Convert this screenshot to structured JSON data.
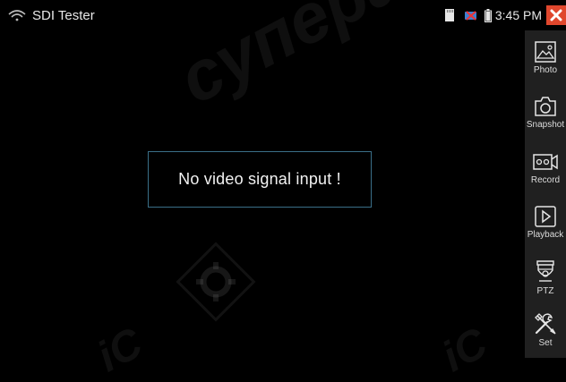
{
  "status_bar": {
    "app_title": "SDI Tester",
    "clock": "3:45 PM"
  },
  "viewport": {
    "message": "No video signal input  !",
    "watermark_main": "cyпepaiC",
    "watermark_small_left": "iC",
    "watermark_small_right": "iC"
  },
  "sidebar": {
    "items": [
      {
        "label": "Photo",
        "icon": "photo-icon"
      },
      {
        "label": "Snapshot",
        "icon": "camera-icon"
      },
      {
        "label": "Record",
        "icon": "record-icon"
      },
      {
        "label": "Playback",
        "icon": "playback-icon"
      },
      {
        "label": "PTZ",
        "icon": "ptz-camera-icon"
      },
      {
        "label": "Set",
        "icon": "tools-icon"
      }
    ]
  },
  "colors": {
    "close_button": "#e0472d",
    "message_border": "#3a6f88",
    "sidebar_bg": "#202020"
  }
}
